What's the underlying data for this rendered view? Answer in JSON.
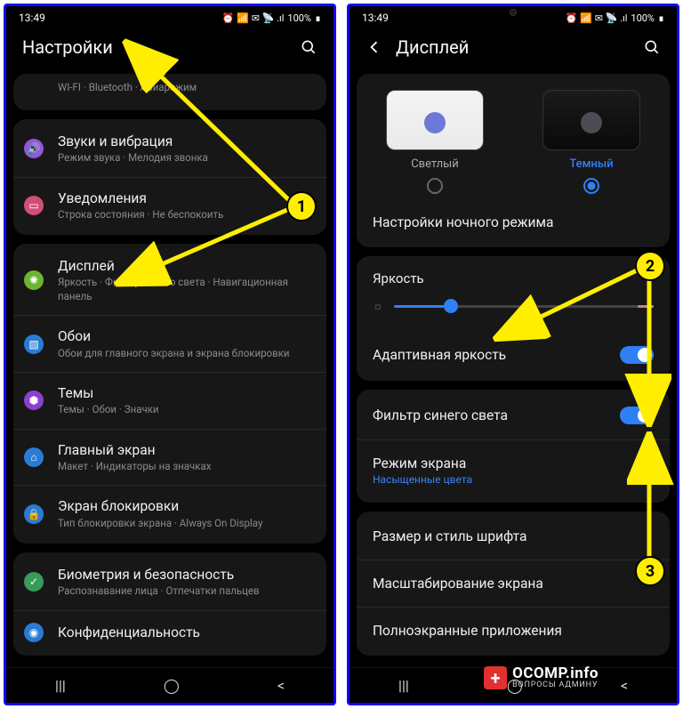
{
  "status": {
    "time": "13:49",
    "battery": "100%",
    "indicators": "⏰ 📶 ✉ 📡 .ıl"
  },
  "left": {
    "title": "Настройки",
    "truncatedTop": "WI-FI · Bluetooth · Авиарежим",
    "items": [
      {
        "title": "Звуки и вибрация",
        "sub": "Режим звука · Мелодия звонка",
        "iconColor": "#8e5bd8",
        "glyph": "🔊"
      },
      {
        "title": "Уведомления",
        "sub": "Строка состояния · Не беспокоить",
        "iconColor": "#d14f74",
        "glyph": "▭"
      }
    ],
    "items2": [
      {
        "title": "Дисплей",
        "sub": "Яркость · Фильтр синего света · Навигационная панель",
        "iconColor": "#6cb52f",
        "glyph": "✺"
      },
      {
        "title": "Обои",
        "sub": "Обои для главного экрана и экрана блокировки",
        "iconColor": "#2a7bd4",
        "glyph": "▧"
      },
      {
        "title": "Темы",
        "sub": "Темы · Обои · Значки",
        "iconColor": "#8f3fd0",
        "glyph": "⬢"
      },
      {
        "title": "Главный экран",
        "sub": "Макет · Индикаторы на значках",
        "iconColor": "#2a7bd4",
        "glyph": "⌂"
      },
      {
        "title": "Экран блокировки",
        "sub": "Тип блокировки экрана · Always On Display",
        "iconColor": "#2a7bd4",
        "glyph": "🔒"
      }
    ],
    "items3": [
      {
        "title": "Биометрия и безопасность",
        "sub": "Распознавание лица · Отпечатки пальцев",
        "iconColor": "#3a9a58",
        "glyph": "✓"
      },
      {
        "title": "Конфиденциальность",
        "sub": "",
        "iconColor": "#2a7bd4",
        "glyph": "◉"
      }
    ]
  },
  "right": {
    "title": "Дисплей",
    "themes": {
      "light": "Светлый",
      "dark": "Темный"
    },
    "nightMode": "Настройки ночного режима",
    "brightness": "Яркость",
    "brightnessPct": 22,
    "adaptive": "Адаптивная яркость",
    "blueFilter": "Фильтр синего света",
    "screenMode": "Режим экрана",
    "screenModeSub": "Насыщенные цвета",
    "fontStyle": "Размер и стиль шрифта",
    "scaling": "Масштабирование экрана",
    "fullscreen": "Полноэкранные приложения"
  },
  "watermark": {
    "brand": "OCOMP",
    "suffix": ".info",
    "sub": "ВОПРОСЫ АДМИНУ"
  },
  "annotations": {
    "b1": "1",
    "b2": "2",
    "b3": "3"
  }
}
